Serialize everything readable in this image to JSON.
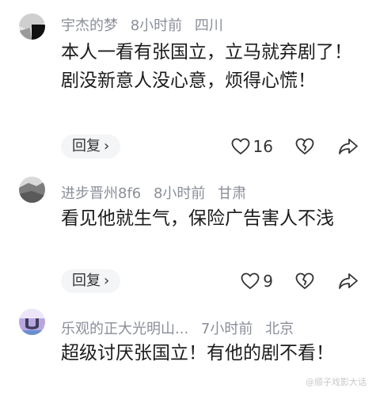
{
  "comments": [
    {
      "username": "宇杰的梦",
      "time": "8小时前",
      "location": "四川",
      "text": "本人一看有张国立，立马就弃剧了！剧没新意人没心意，烦得心慌！",
      "reply_label": "回复",
      "likes": "16",
      "avatar_icon": "avatar-dark-image"
    },
    {
      "username": "进步晋州8f6",
      "time": "8小时前",
      "location": "甘肃",
      "text": "看见他就生气，保险广告害人不浅",
      "reply_label": "回复",
      "likes": "9",
      "avatar_icon": "avatar-gray-image"
    },
    {
      "username": "乐观的正大光明山...",
      "time": "7小时前",
      "location": "北京",
      "text": "超级讨厌张国立！有他的剧不看！",
      "avatar_icon": "avatar-purple-image"
    }
  ],
  "icons": {
    "reply_chevron": "chevron-right-icon",
    "like": "heart-outline-icon",
    "dislike": "broken-heart-icon",
    "share": "share-arrow-icon"
  },
  "colors": {
    "meta_text": "#8a8f99",
    "body_text": "#1c1c1c",
    "reply_bg": "#f4f5f7"
  },
  "watermark": "@顺子戏影大话"
}
